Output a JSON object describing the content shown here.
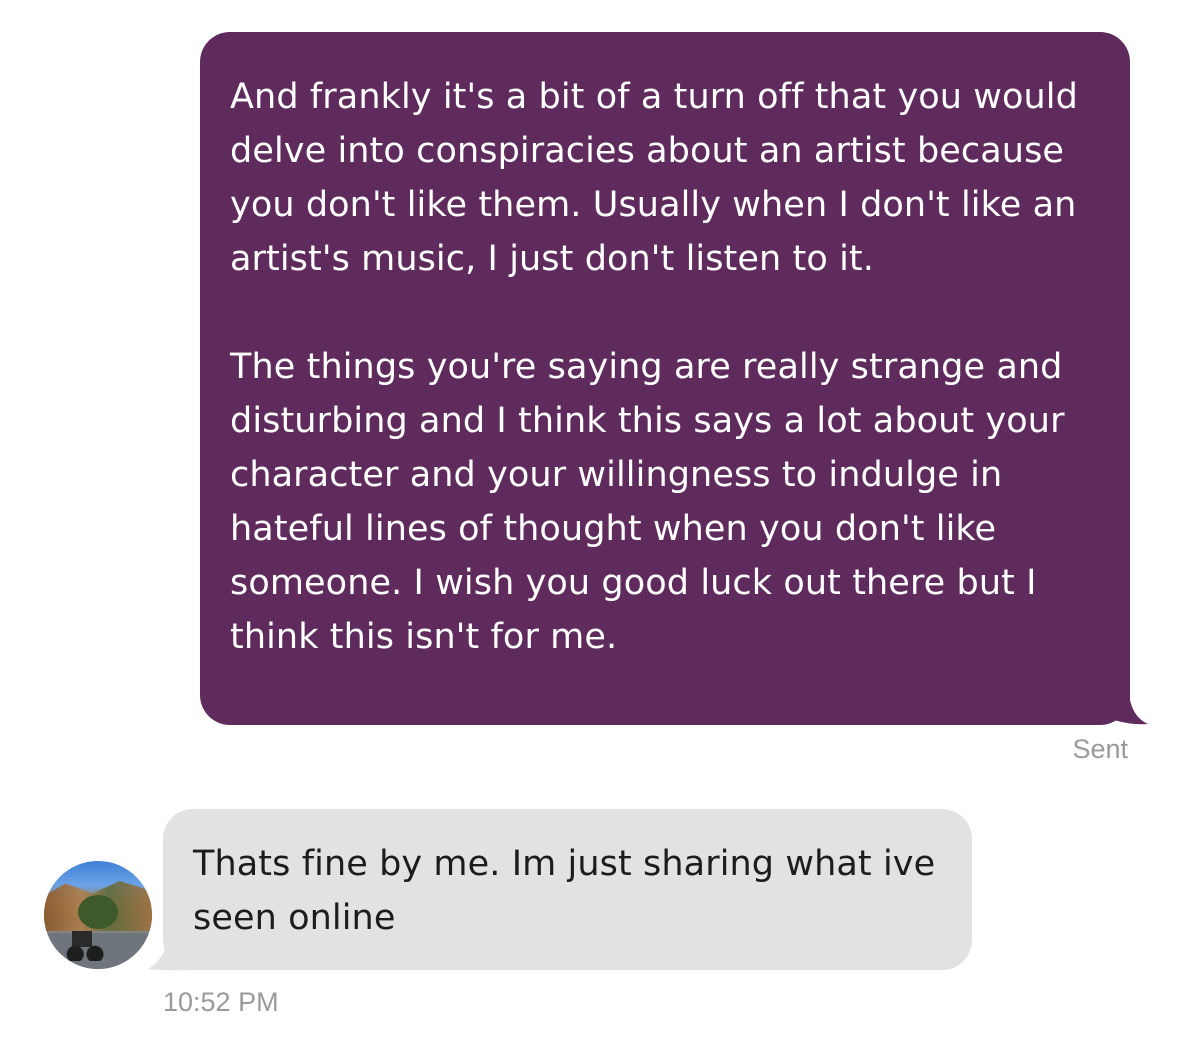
{
  "colors": {
    "sent_bubble": "#5e2b5c",
    "received_bubble": "#e2e2e2",
    "status_text": "#9a9a9a"
  },
  "messages": {
    "sent": {
      "paragraphs": [
        "And frankly it's a bit of a turn off that you would delve into conspiracies about an artist because you don't like them. Usually when I don't like an artist's music, I just don't listen to it.",
        "The things you're saying are really strange and disturbing and I think this says a lot about your character and your willingness to indulge in hateful lines of thought when you don't like someone. I wish you good luck out there but I think this isn't for me."
      ],
      "status": "Sent"
    },
    "received": {
      "text": "Thats fine by me. Im just sharing what ive seen online",
      "time": "10:52 PM",
      "avatar_icon": "contact-avatar"
    }
  }
}
